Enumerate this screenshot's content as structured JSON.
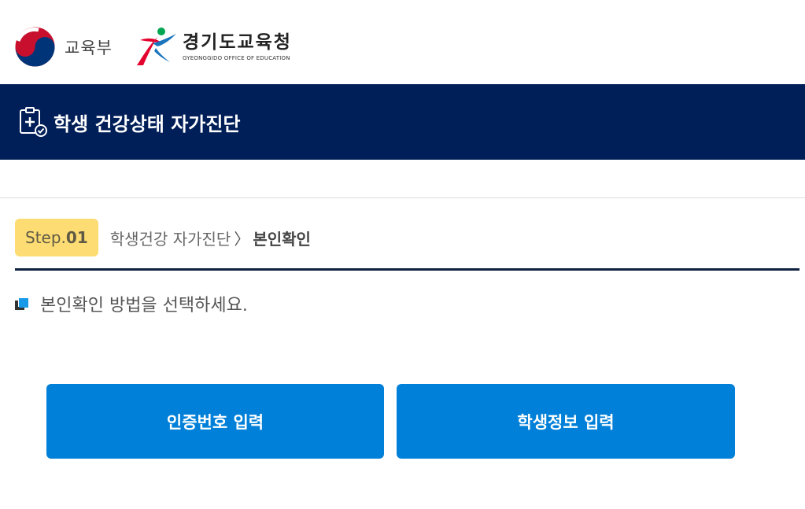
{
  "header": {
    "moe_name": "교육부",
    "goe_name": "경기도교육청",
    "goe_english": "GYEONGGIDO OFFICE OF EDUCATION"
  },
  "title_bar": {
    "icon": "health-checklist-icon",
    "title": "학생 건강상태 자가진단"
  },
  "step": {
    "prefix": "Step.",
    "number": "01",
    "breadcrumb_parent": "학생건강 자가진단",
    "breadcrumb_separator": "〉",
    "breadcrumb_current": "본인확인"
  },
  "instruction": "본인확인 방법을 선택하세요.",
  "buttons": {
    "certificate_label": "인증번호 입력",
    "student_info_label": "학생정보 입력"
  },
  "colors": {
    "navy": "#001e57",
    "accent_blue": "#0080d8",
    "step_yellow": "#fddc73"
  }
}
